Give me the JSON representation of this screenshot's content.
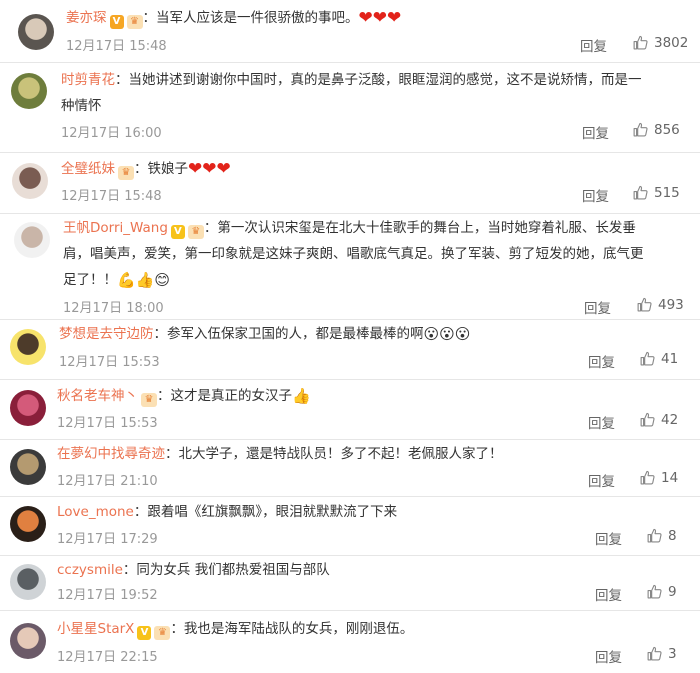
{
  "comments": [
    {
      "name": "姜亦琛",
      "badges": [
        "v-orange",
        "fan"
      ],
      "text": "：当军人应该是一件很骄傲的事吧。",
      "trail": [
        "heart",
        "heart",
        "heart"
      ],
      "time": "12月17日 15:48",
      "reply": "回复",
      "likes": "3802"
    },
    {
      "name": "时剪青花",
      "badges": [],
      "text": "：当她讲述到谢谢你中国时，真的是鼻子泛酸，眼眶湿润的感觉，这不是说矫情，而是一",
      "text2": "种情怀",
      "trail": [],
      "time": "12月17日 16:00",
      "reply": "回复",
      "likes": "856"
    },
    {
      "name": "全璧纸妹",
      "badges": [
        "fan"
      ],
      "text": "：铁娘子",
      "trail": [
        "heart",
        "heart",
        "heart"
      ],
      "time": "12月17日 15:48",
      "reply": "回复",
      "likes": "515"
    },
    {
      "name": "王帆Dorri_Wang",
      "badges": [
        "v-yellow",
        "fan"
      ],
      "text": "：第一次认识宋玺是在北大十佳歌手的舞台上，当时她穿着礼服、长发垂",
      "text2": "肩，唱美声，爱笑，第一印象就是这妹子爽朗、唱歌底气真足。换了军装、剪了短发的她，底气更",
      "text3": "足了！！",
      "trail3": [
        "muscle",
        "thumb",
        "smile"
      ],
      "time": "12月17日 18:00",
      "reply": "回复",
      "likes": "493"
    },
    {
      "name": "梦想是去守边防",
      "badges": [],
      "text": "：参军入伍保家卫国的人，都是最棒最棒的啊",
      "trail": [
        "face",
        "face",
        "face"
      ],
      "time": "12月17日 15:53",
      "reply": "回复",
      "likes": "41"
    },
    {
      "name": "秋名老车神丶",
      "badges": [
        "fan"
      ],
      "text": "：这才是真正的女汉子",
      "trail": [
        "thumb"
      ],
      "time": "12月17日 15:53",
      "reply": "回复",
      "likes": "42"
    },
    {
      "name": "在夢幻中找尋奇迹",
      "badges": [],
      "text": "：北大学子，還是特战队员！多了不起！老佩服人家了！",
      "trail": [],
      "time": "12月17日 21:10",
      "reply": "回复",
      "likes": "14"
    },
    {
      "name": "Love_mone",
      "badges": [],
      "text": "：跟着唱《红旗飘飘》，眼泪就默默流了下来",
      "trail": [],
      "time": "12月17日 17:29",
      "reply": "回复",
      "likes": "8"
    },
    {
      "name": "cczysmile",
      "badges": [],
      "text": "：同为女兵  我们都热爱祖国与部队",
      "trail": [],
      "time": "12月17日 19:52",
      "reply": "回复",
      "likes": "9"
    },
    {
      "name": "小星星StarX",
      "badges": [
        "v-yellow",
        "fan"
      ],
      "text": "：我也是海军陆战队的女兵，刚刚退伍。",
      "trail": [],
      "time": "12月17日 22:15",
      "reply": "回复",
      "likes": "3"
    }
  ],
  "colors": {
    "name": "#eb7350",
    "text": "#333333",
    "meta": "#999999",
    "heart": "#e2231a",
    "badge_v": "#f6a623"
  },
  "icons": {
    "like": "thumbs-up-icon",
    "vip": "v-badge-icon",
    "fan": "fan-badge-icon"
  }
}
